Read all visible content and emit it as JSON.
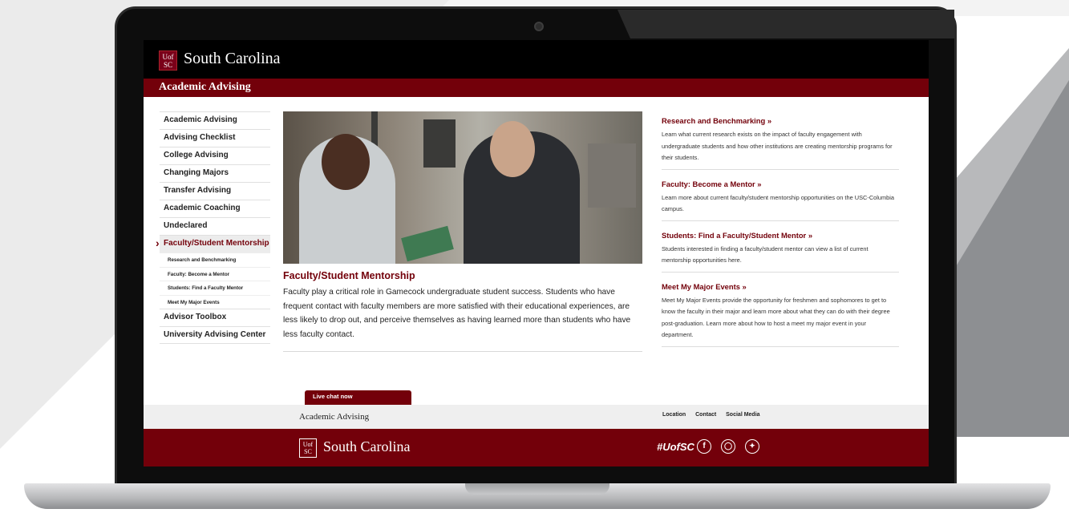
{
  "header": {
    "logo_text": "UofSC",
    "brand": "South Carolina",
    "section_title": "Academic Advising"
  },
  "nav": {
    "items": [
      {
        "label": "Academic Advising"
      },
      {
        "label": "Advising Checklist"
      },
      {
        "label": "College Advising"
      },
      {
        "label": "Changing Majors"
      },
      {
        "label": "Transfer Advising"
      },
      {
        "label": "Academic Coaching"
      },
      {
        "label": "Undeclared"
      },
      {
        "label": "Faculty/Student Mentorship"
      }
    ],
    "sub_items": [
      {
        "label": "Research and Benchmarking"
      },
      {
        "label": "Faculty: Become a Mentor"
      },
      {
        "label": "Students: Find a Faculty Mentor"
      },
      {
        "label": "Meet My Major Events"
      }
    ],
    "bottom_items": [
      {
        "label": "Advisor Toolbox"
      },
      {
        "label": "University Advising Center"
      }
    ],
    "active": "Faculty/Student Mentorship"
  },
  "main": {
    "title": "Faculty/Student Mentorship",
    "body": "Faculty play a critical role in Gamecock undergraduate student success.  Students who have frequent contact with faculty members are more satisfied with their educational experiences, are less likely to drop out, and perceive themselves as having learned more than students who have less faculty contact."
  },
  "sidebar_right": [
    {
      "title": "Research and Benchmarking »",
      "body": "Learn what current research exists on the impact of faculty engagement with undergraduate students and how other institutions are creating mentorship programs for their students."
    },
    {
      "title": "Faculty: Become a Mentor »",
      "body": "Learn more about current faculty/student mentorship opportunities on the USC-Columbia campus."
    },
    {
      "title": "Students: Find a Faculty/Student Mentor »",
      "body": "Students interested in finding a faculty/student mentor can view a list of current mentorship opportunities here."
    },
    {
      "title": "Meet My Major Events »",
      "body": "Meet My Major Events provide the opportunity for freshmen and sophomores to get to know the faculty in their major and learn more about what they can do with their degree post-graduation. Learn more about how to host a meet my major event in your department."
    }
  ],
  "chat": {
    "label": "Live chat now"
  },
  "footer": {
    "title": "Academic Advising",
    "links": [
      "Location",
      "Contact",
      "Social Media"
    ],
    "brand": "South Carolina",
    "logo_text": "UofSC",
    "hashtag": "#UofSC",
    "social_icons": [
      "facebook-icon",
      "instagram-icon",
      "twitter-icon"
    ]
  },
  "colors": {
    "garnet": "#73000a",
    "black": "#000000",
    "footer_gray": "#efefef"
  }
}
